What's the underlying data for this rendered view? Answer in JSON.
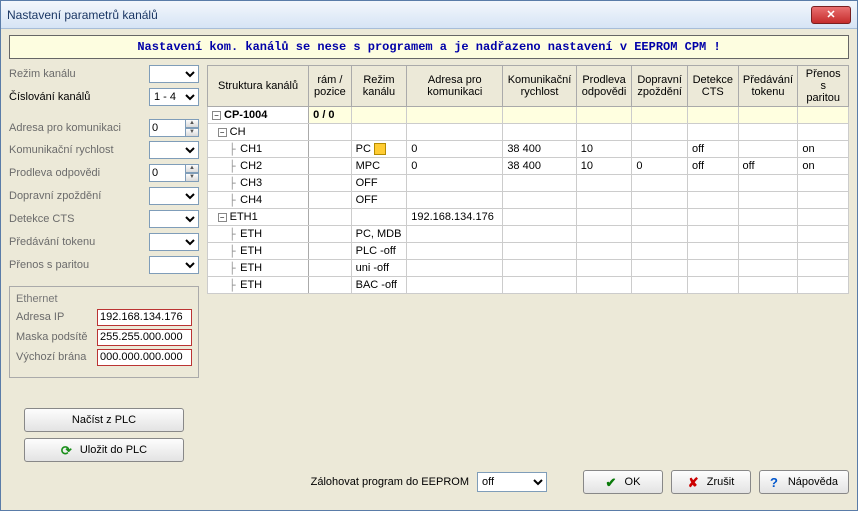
{
  "window": {
    "title": "Nastavení parametrů kanálů"
  },
  "banner": "Nastavení kom. kanálů se nese s programem a je nadřazeno nastavení v EEPROM CPM !",
  "left": {
    "rezim_kanalu": "Režim kanálu",
    "cislovani": "Číslování kanálů",
    "cislovani_val": "1 - 4",
    "adresa_kom": "Adresa pro komunikaci",
    "adresa_kom_val": "0",
    "kom_rychlost": "Komunikační rychlost",
    "prodleva": "Prodleva odpovědi",
    "prodleva_val": "0",
    "dopr_zpozdeni": "Dopravní zpoždění",
    "detekce_cts": "Detekce CTS",
    "predavani": "Předávání tokenu",
    "prenos_paritou": "Přenos s paritou",
    "eth": {
      "legend": "Ethernet",
      "ip_lbl": "Adresa IP",
      "ip": "192.168.134.176",
      "mask_lbl": "Maska podsítě",
      "mask": "255.255.000.000",
      "gw_lbl": "Výchozí brána",
      "gw": "000.000.000.000"
    },
    "btn_read": "Načíst z PLC",
    "btn_save": "Uložit do PLC"
  },
  "table": {
    "headers": {
      "struct": "Struktura kanálů",
      "frame": "rám / pozice",
      "mode": "Režim kanálu",
      "addr": "Adresa pro komunikaci",
      "speed": "Komunikační rychlost",
      "delay": "Prodleva odpovědi",
      "tdelay": "Dopravní zpoždění",
      "cts": "Detekce CTS",
      "token": "Předávání tokenu",
      "parity": "Přenos s paritou"
    },
    "rows": [
      {
        "tree": "CP-1004",
        "lvl": 0,
        "exp": "-",
        "bold": true,
        "hl": true,
        "frame": "0 / 0"
      },
      {
        "tree": "CH",
        "lvl": 1,
        "exp": "-"
      },
      {
        "tree": "CH1",
        "lvl": 2,
        "mode": "PC",
        "modeicon": true,
        "addr": "0",
        "speed": "38 400",
        "delay": "10",
        "cts": "off",
        "parity": "on"
      },
      {
        "tree": "CH2",
        "lvl": 2,
        "mode": "MPC",
        "addr": "0",
        "speed": "38 400",
        "delay": "10",
        "tdelay": "0",
        "cts": "off",
        "token": "off",
        "parity": "on"
      },
      {
        "tree": "CH3",
        "lvl": 2,
        "mode": "OFF"
      },
      {
        "tree": "CH4",
        "lvl": 2,
        "mode": "OFF"
      },
      {
        "tree": "ETH1",
        "lvl": 1,
        "exp": "-",
        "addr": "192.168.134.176"
      },
      {
        "tree": "ETH",
        "lvl": 2,
        "mode": "PC, MDB"
      },
      {
        "tree": "ETH",
        "lvl": 2,
        "mode": "PLC -off"
      },
      {
        "tree": "ETH",
        "lvl": 2,
        "mode": "uni -off"
      },
      {
        "tree": "ETH",
        "lvl": 2,
        "mode": "BAC -off"
      }
    ]
  },
  "bottom": {
    "backup_lbl": "Zálohovat program do EEPROM",
    "backup_val": "off",
    "ok": "OK",
    "cancel": "Zrušit",
    "help": "Nápověda"
  }
}
